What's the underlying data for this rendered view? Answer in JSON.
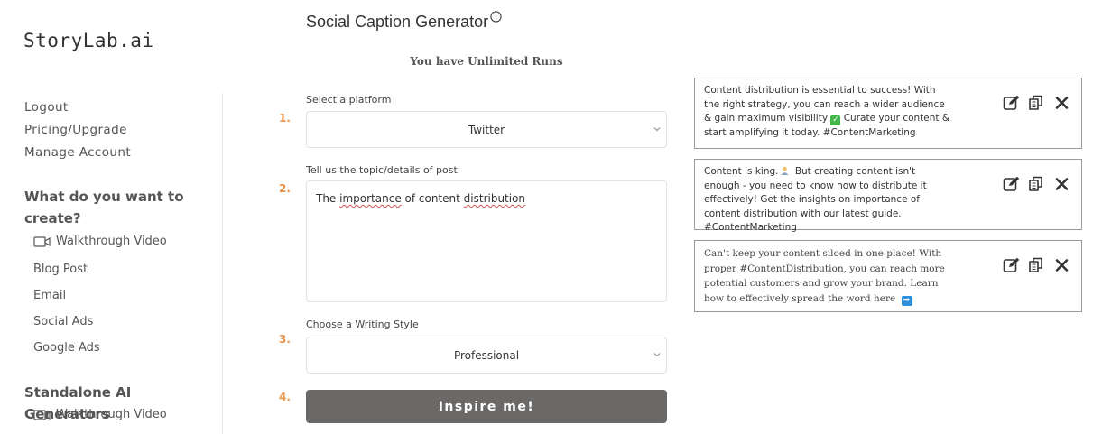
{
  "brand": {
    "logo_text": "StoryLab.ai"
  },
  "sidebar": {
    "links": [
      "Logout",
      "Pricing/Upgrade",
      "Manage Account"
    ],
    "create_heading_line1": "What do you want to",
    "create_heading_line2": "create?",
    "create_items": [
      "Walkthrough Video",
      "Blog Post",
      "Email",
      "Social Ads",
      "Google Ads"
    ],
    "standalone_heading": "Standalone AI Generators",
    "standalone_items": [
      "Walkthrough Video"
    ]
  },
  "main": {
    "title": "Social Caption Generator",
    "runs_text": "You have Unlimited Runs",
    "steps": [
      {
        "number": "1.",
        "label": "Select a platform",
        "value": "Twitter"
      },
      {
        "number": "2.",
        "label": "Tell us the topic/details of post",
        "value_parts": [
          "The ",
          "importance",
          " of content ",
          "distribution"
        ]
      },
      {
        "number": "3.",
        "label": "Choose a Writing Style",
        "value": "Professional"
      },
      {
        "number": "4.",
        "button_label": "Inspire me!"
      }
    ]
  },
  "captions": [
    {
      "text_before": "Content distribution is essential to success! With the right strategy, you can reach a wider audience & gain maximum visibility ",
      "emoji": "check",
      "text_after": " Curate your content & start amplifying it today. #ContentMarketing"
    },
    {
      "text_before": "Content is king.",
      "emoji": "person",
      "text_after": " But creating content isn't enough - you need to know how to distribute it effectively! Get the insights on importance of content distribution with our latest guide. #ContentMarketing"
    },
    {
      "text_before": "Can't keep your content siloed in one place! With proper #ContentDistribution, you can reach more potential customers and grow your brand. Learn how to effectively spread the word here ",
      "emoji": "arrow",
      "text_after": ""
    }
  ],
  "icons": {
    "edit": "edit-icon",
    "copy": "copy-icon",
    "close": "close-icon",
    "info": "info-icon",
    "video": "video-camera-icon",
    "chevron": "chevron-down-icon"
  },
  "colors": {
    "step_number": "#e8944a",
    "button_bg": "#6b6868",
    "card_border": "#9a9a9a"
  }
}
